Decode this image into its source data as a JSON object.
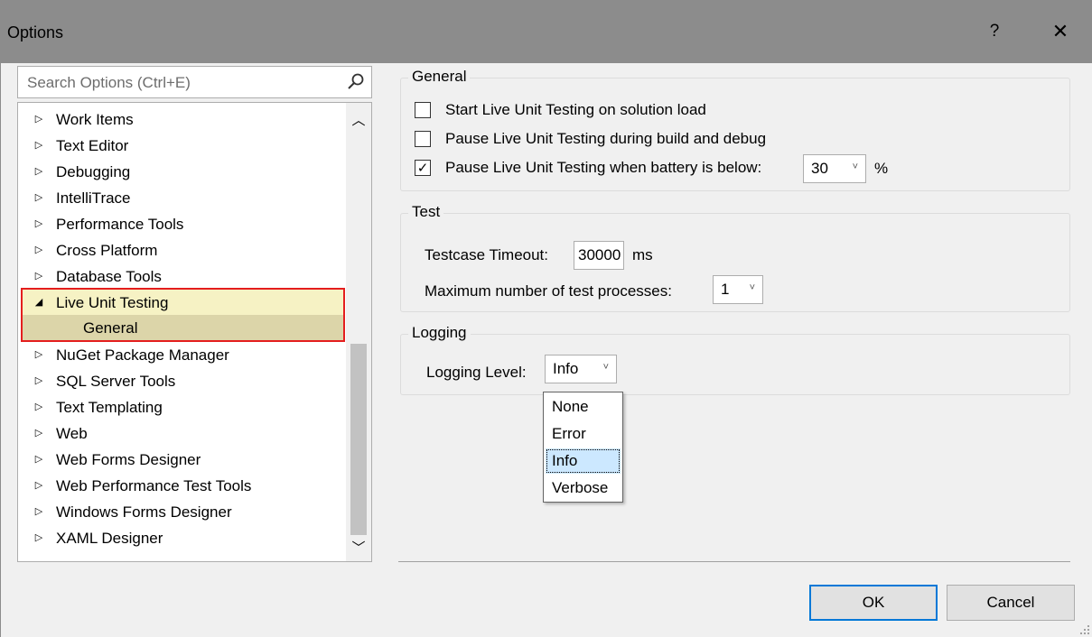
{
  "window": {
    "title": "Options",
    "help_glyph": "?",
    "close_glyph": "✕"
  },
  "search": {
    "placeholder": "Search Options (Ctrl+E)"
  },
  "tree": {
    "items": [
      {
        "label": "Work Items",
        "arrow": "▷"
      },
      {
        "label": "Text Editor",
        "arrow": "▷"
      },
      {
        "label": "Debugging",
        "arrow": "▷"
      },
      {
        "label": "IntelliTrace",
        "arrow": "▷"
      },
      {
        "label": "Performance Tools",
        "arrow": "▷"
      },
      {
        "label": "Cross Platform",
        "arrow": "▷"
      },
      {
        "label": "Database Tools",
        "arrow": "▷"
      },
      {
        "label": "Live Unit Testing",
        "arrow": "◢"
      },
      {
        "label": "General",
        "arrow": ""
      },
      {
        "label": "NuGet Package Manager",
        "arrow": "▷"
      },
      {
        "label": "SQL Server Tools",
        "arrow": "▷"
      },
      {
        "label": "Text Templating",
        "arrow": "▷"
      },
      {
        "label": "Web",
        "arrow": "▷"
      },
      {
        "label": "Web Forms Designer",
        "arrow": "▷"
      },
      {
        "label": "Web Performance Test Tools",
        "arrow": "▷"
      },
      {
        "label": "Windows Forms Designer",
        "arrow": "▷"
      },
      {
        "label": "XAML Designer",
        "arrow": "▷"
      }
    ],
    "scroll_up_glyph": "︿",
    "scroll_down_glyph": "﹀"
  },
  "general_group": {
    "legend": "General",
    "start_on_load": {
      "label": "Start Live Unit Testing on solution load",
      "checked": false,
      "mark": ""
    },
    "pause_build": {
      "label": "Pause Live Unit Testing during build and debug",
      "checked": false,
      "mark": ""
    },
    "pause_battery": {
      "label": "Pause Live Unit Testing when battery is below:",
      "checked": true,
      "mark": "✓"
    },
    "battery_value": "30",
    "battery_unit": "%"
  },
  "test_group": {
    "legend": "Test",
    "timeout_label": "Testcase Timeout:",
    "timeout_value": "30000",
    "timeout_unit": "ms",
    "max_processes_label": "Maximum number of test processes:",
    "max_processes_value": "1"
  },
  "logging_group": {
    "legend": "Logging",
    "level_label": "Logging Level:",
    "level_value": "Info",
    "options": [
      "None",
      "Error",
      "Info",
      "Verbose"
    ],
    "selected_option": "Info"
  },
  "combo_arrow_glyph": "˅",
  "buttons": {
    "ok": "OK",
    "cancel": "Cancel"
  }
}
